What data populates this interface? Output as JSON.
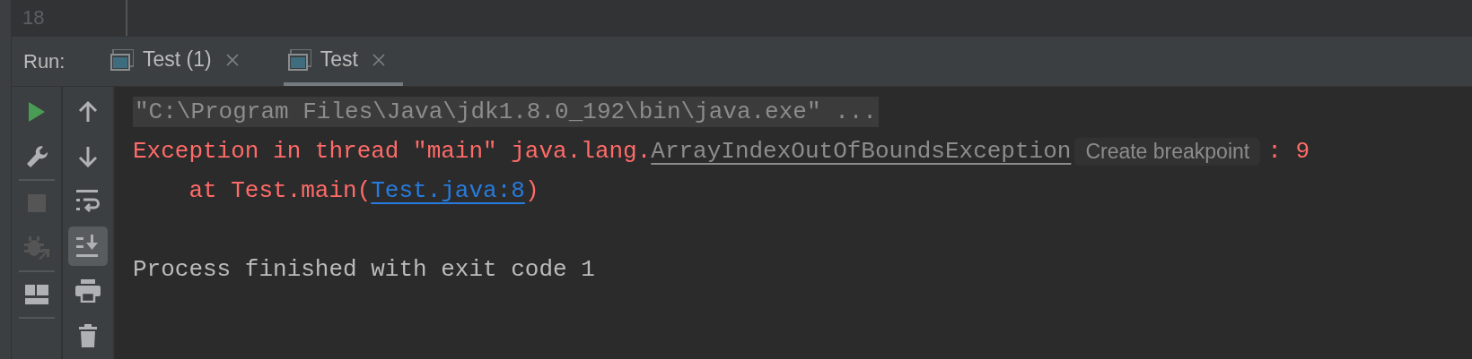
{
  "editor": {
    "line_number": "18"
  },
  "run_panel": {
    "label": "Run:",
    "tabs": [
      {
        "label": "Test (1)",
        "selected": false
      },
      {
        "label": "Test",
        "selected": true
      }
    ]
  },
  "left_tools": [
    {
      "kind": "run",
      "disabled": false
    },
    {
      "kind": "wrench",
      "disabled": false
    },
    {
      "kind": "divider"
    },
    {
      "kind": "stop",
      "disabled": true
    },
    {
      "kind": "bug",
      "disabled": true
    },
    {
      "kind": "divider"
    },
    {
      "kind": "layout",
      "disabled": false
    },
    {
      "kind": "divider"
    }
  ],
  "right_tools": [
    {
      "kind": "up",
      "on": false
    },
    {
      "kind": "down",
      "on": false
    },
    {
      "kind": "wrap",
      "on": false
    },
    {
      "kind": "scroll_end",
      "on": true
    },
    {
      "kind": "print",
      "on": false
    },
    {
      "kind": "trash",
      "on": false
    }
  ],
  "console": [
    {
      "kind": "command",
      "segments": [
        {
          "kind": "text",
          "text": "\"C:\\Program Files\\Java\\jdk1.8.0_192\\bin\\java.exe\" ..."
        }
      ]
    },
    {
      "kind": "error",
      "segments": [
        {
          "kind": "text",
          "text": "Exception in thread \"main\" java.lang."
        },
        {
          "kind": "class_link",
          "text": "ArrayIndexOutOfBoundsException"
        },
        {
          "kind": "hint",
          "text": "Create breakpoint"
        },
        {
          "kind": "text",
          "text": ": 9"
        }
      ]
    },
    {
      "kind": "error",
      "segments": [
        {
          "kind": "text",
          "text": "    at Test.main("
        },
        {
          "kind": "file_link",
          "text": "Test.java:8"
        },
        {
          "kind": "text",
          "text": ")"
        }
      ]
    },
    {
      "kind": "blank"
    },
    {
      "kind": "info",
      "segments": [
        {
          "kind": "text",
          "text": "Process finished with exit code 1"
        }
      ]
    }
  ]
}
